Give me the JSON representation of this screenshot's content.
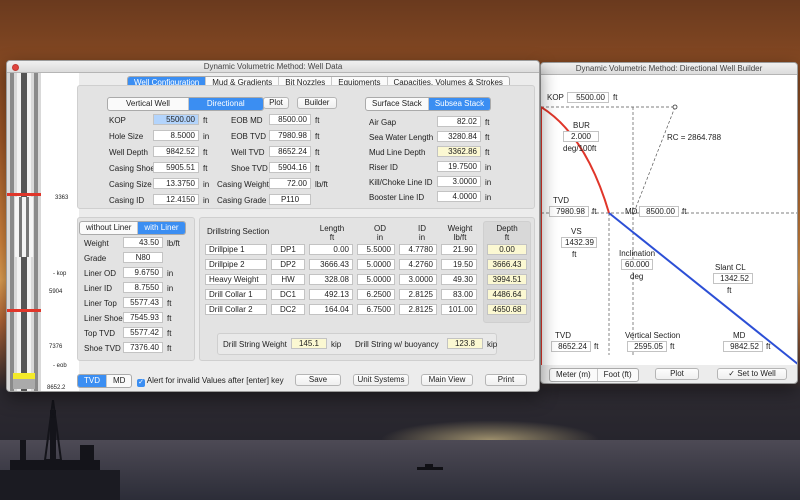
{
  "main_window": {
    "title": "Dynamic Volumetric Method: Well Data",
    "tabs": [
      {
        "label": "Well Configuration",
        "active": true
      },
      {
        "label": "Mud & Gradients",
        "active": false
      },
      {
        "label": "Bit Nozzles",
        "active": false
      },
      {
        "label": "Equipments",
        "active": false
      },
      {
        "label": "Capacities, Volumes & Strokes",
        "active": false
      }
    ],
    "well_type": [
      "Vertical Well",
      "Directional"
    ],
    "plot_label": "Plot",
    "builder_label": "Builder",
    "stack_type": [
      "Surface Stack",
      "Subsea Stack"
    ],
    "well_fields": [
      {
        "label": "KOP",
        "value": "5500.00",
        "unit": "ft"
      },
      {
        "label": "Hole Size",
        "value": "8.5000",
        "unit": "in"
      },
      {
        "label": "Well Depth",
        "value": "9842.52",
        "unit": "ft"
      },
      {
        "label": "Casing Shoe",
        "value": "5905.51",
        "unit": "ft"
      },
      {
        "label": "Casing Size",
        "value": "13.3750",
        "unit": "in"
      },
      {
        "label": "Casing ID",
        "value": "12.4150",
        "unit": "in"
      }
    ],
    "eob_fields": [
      {
        "label": "EOB MD",
        "value": "8500.00",
        "unit": "ft"
      },
      {
        "label": "EOB TVD",
        "value": "7980.98",
        "unit": "ft"
      },
      {
        "label": "Well TVD",
        "value": "8652.24",
        "unit": "ft"
      },
      {
        "label": "Shoe TVD",
        "value": "5904.16",
        "unit": "ft"
      },
      {
        "label": "Casing Weight",
        "value": "72.00",
        "unit": "lb/ft"
      },
      {
        "label": "Casing Grade",
        "value": "P110",
        "unit": ""
      }
    ],
    "subsea_fields": [
      {
        "label": "Air Gap",
        "value": "82.02",
        "unit": "ft"
      },
      {
        "label": "Sea Water Length",
        "value": "3280.84",
        "unit": "ft"
      },
      {
        "label": "Mud Line Depth",
        "value": "3362.86",
        "unit": "ft"
      },
      {
        "label": "Riser ID",
        "value": "19.7500",
        "unit": "in"
      },
      {
        "label": "Kill/Choke Line ID",
        "value": "3.0000",
        "unit": "in"
      },
      {
        "label": "Booster Line ID",
        "value": "4.0000",
        "unit": "in"
      }
    ],
    "liner_toggle": [
      "without Liner",
      "with Liner"
    ],
    "liner_fields": [
      {
        "label": "Weight",
        "value": "43.50",
        "unit": "lb/ft"
      },
      {
        "label": "Grade",
        "value": "N80",
        "unit": ""
      },
      {
        "label": "Liner OD",
        "value": "9.6750",
        "unit": "in"
      },
      {
        "label": "Liner ID",
        "value": "8.7550",
        "unit": "in"
      },
      {
        "label": "Liner Top",
        "value": "5577.43",
        "unit": "ft"
      },
      {
        "label": "Liner Shoe",
        "value": "7545.93",
        "unit": "ft"
      },
      {
        "label": "Top TVD",
        "value": "5577.42",
        "unit": "ft"
      },
      {
        "label": "Shoe TVD",
        "value": "7376.40",
        "unit": "ft"
      }
    ],
    "drillstring": {
      "headers": [
        "Drillstring Section",
        "Length\nft",
        "OD\nin",
        "ID\nin",
        "Weight\nlb/ft",
        "Depth\nft"
      ],
      "rows": [
        {
          "name": "Drillpipe 1",
          "code": "DP1",
          "length": "0.00",
          "od": "5.5000",
          "id": "4.7780",
          "weight": "21.90",
          "depth": "0.00"
        },
        {
          "name": "Drillpipe 2",
          "code": "DP2",
          "length": "3666.43",
          "od": "5.0000",
          "id": "4.2760",
          "weight": "19.50",
          "depth": "3666.43"
        },
        {
          "name": "Heavy Weight",
          "code": "HW",
          "length": "328.08",
          "od": "5.0000",
          "id": "3.0000",
          "weight": "49.30",
          "depth": "3994.51"
        },
        {
          "name": "Drill Collar 1",
          "code": "DC1",
          "length": "492.13",
          "od": "6.2500",
          "id": "2.8125",
          "weight": "83.00",
          "depth": "4486.64"
        },
        {
          "name": "Drill Collar 2",
          "code": "DC2",
          "length": "164.04",
          "od": "6.7500",
          "id": "2.8125",
          "weight": "101.00",
          "depth": "4650.68"
        }
      ],
      "string_weight_label": "Drill String Weight",
      "string_weight_value": "145.1",
      "string_weight_unit": "kip",
      "buoyancy_label": "Drill String w/ buoyancy",
      "buoyancy_value": "123.8",
      "buoyancy_unit": "kip"
    },
    "bottom": {
      "tvd_md": [
        "TVD",
        "MD"
      ],
      "alert_label": "Alert for invalid Values after [enter] key",
      "alert_checked": true,
      "save": "Save",
      "unit_systems": "Unit Systems",
      "main_view": "Main View",
      "print": "Print"
    },
    "well_image_labels": {
      "depth_top": "3363",
      "kop": "- kop",
      "depth_shoe": "5904",
      "depth_liner": "7376",
      "eob": "- eob",
      "depth_bottom": "8652.2"
    }
  },
  "builder_window": {
    "title": "Dynamic Volumetric Method: Directional Well Builder",
    "kop_label": "KOP",
    "kop_value": "5500.00",
    "kop_unit": "ft",
    "bur_label": "BUR",
    "bur_value": "2.000",
    "bur_unit": "deg/100ft",
    "rc_label": "RC =  2864.788",
    "tvd_label": "TVD",
    "tvd_value": "7980.98",
    "tvd_unit": "ft",
    "md_label": "MD",
    "md_value": "8500.00",
    "md_unit": "ft",
    "vs_label": "VS",
    "vs_value": "1432.39",
    "vs_unit": "ft",
    "inclination_label": "Inclination",
    "inclination_value": "60.000",
    "inclination_unit": "deg",
    "slant_label": "Slant CL",
    "slant_value": "1342.52",
    "slant_unit": "ft",
    "bottom_tvd_label": "TVD",
    "bottom_tvd_value": "8652.24",
    "bottom_tvd_unit": "ft",
    "vertical_section_label": "Vertical Section",
    "vertical_section_value": "2595.05",
    "vertical_section_unit": "ft",
    "bottom_md_label": "MD",
    "bottom_md_value": "9842.52",
    "bottom_md_unit": "ft",
    "units_toggle": [
      "Meter (m)",
      "Foot (ft)"
    ],
    "plot_label": "Plot",
    "set_to_well_label": "Set to Well",
    "colors": {
      "build_curve": "#e0362a",
      "tangent": "#2c4fd6"
    }
  }
}
